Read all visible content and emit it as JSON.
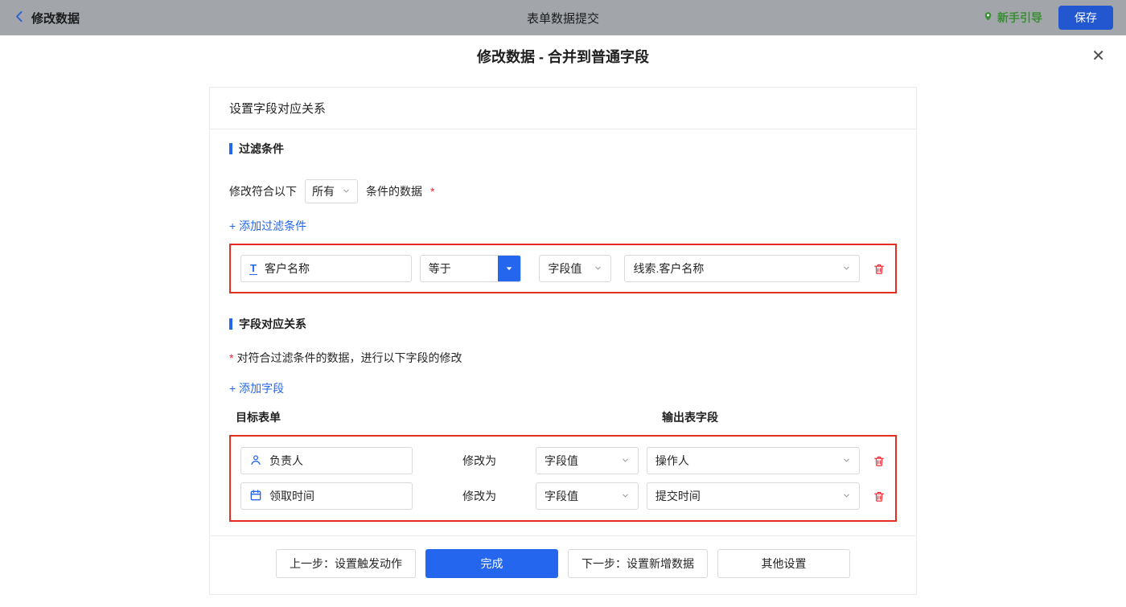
{
  "topbar": {
    "back_label": "修改数据",
    "title": "表单数据提交",
    "guide_label": "新手引导",
    "save_label": "保存"
  },
  "modal": {
    "title": "修改数据 - 合并到普通字段",
    "close_glyph": "✕"
  },
  "panel": {
    "header": "设置字段对应关系",
    "filter": {
      "section_title": "过滤条件",
      "condition_prefix": "修改符合以下",
      "match_mode": "所有",
      "condition_suffix": "条件的数据",
      "required_mark": "*",
      "add_link": "+ 添加过滤条件",
      "rows": [
        {
          "field": "客户名称",
          "operator": "等于",
          "value_type": "字段值",
          "value": "线索.客户名称"
        }
      ]
    },
    "mapping": {
      "section_title": "字段对应关系",
      "required_mark": "*",
      "description": "对符合过滤条件的数据，进行以下字段的修改",
      "add_link": "+ 添加字段",
      "columns": {
        "target": "目标表单",
        "output": "输出表字段"
      },
      "rows": [
        {
          "field": "负责人",
          "action": "修改为",
          "value_type": "字段值",
          "value": "操作人"
        },
        {
          "field": "领取时间",
          "action": "修改为",
          "value_type": "字段值",
          "value": "提交时间"
        }
      ]
    },
    "footer": {
      "prev": "上一步：设置触发动作",
      "done": "完成",
      "next": "下一步：设置新增数据",
      "other": "其他设置"
    }
  },
  "icons": {
    "text_field_glyph": "T"
  },
  "colors": {
    "accent": "#2467ee",
    "highlight_border": "#e12f21",
    "trash_red": "#f5222d",
    "guide_green": "#3a8e33",
    "topbar_bg": "#a2a6ab"
  }
}
